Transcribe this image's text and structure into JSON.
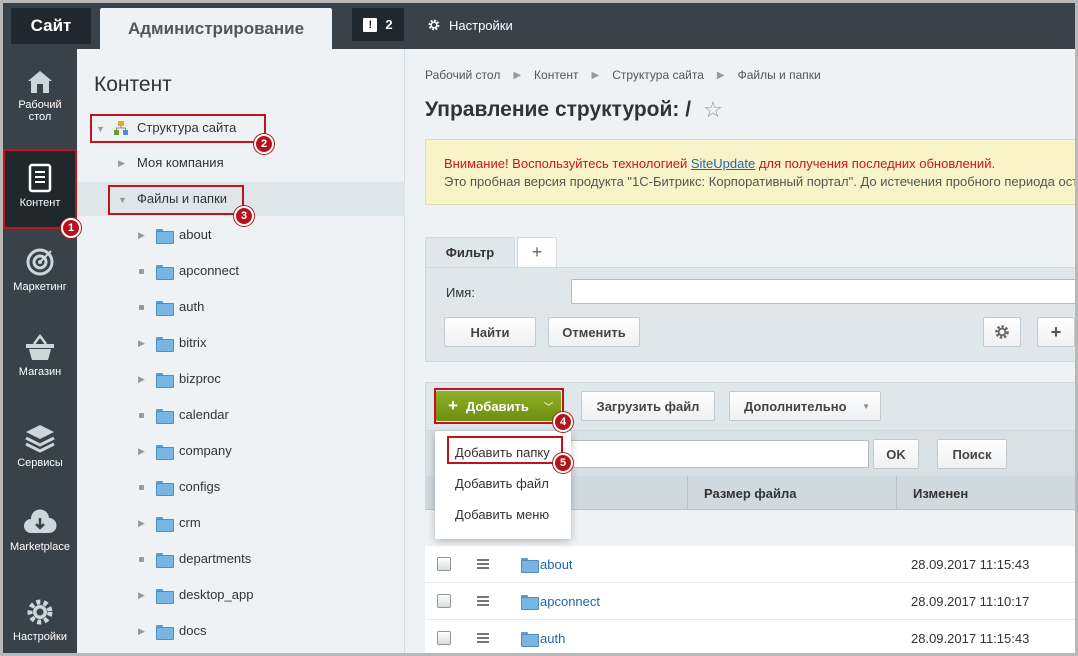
{
  "topbar": {
    "site_label": "Сайт",
    "admin_label": "Администрирование",
    "notifications_count": "2",
    "settings_label": "Настройки"
  },
  "leftnav": {
    "items": [
      {
        "label": "Рабочий стол",
        "icon": "home-icon"
      },
      {
        "label": "Контент",
        "icon": "document-icon",
        "active": true
      },
      {
        "label": "Маркетинг",
        "icon": "target-icon"
      },
      {
        "label": "Магазин",
        "icon": "basket-icon"
      },
      {
        "label": "Сервисы",
        "icon": "layers-icon"
      },
      {
        "label": "Marketplace",
        "icon": "cloud-download-icon"
      },
      {
        "label": "Настройки",
        "icon": "gear-icon"
      }
    ]
  },
  "tree": {
    "title": "Контент",
    "site_structure": "Структура сайта",
    "my_company": "Моя компания",
    "files_and_folders": "Файлы и папки",
    "folders": [
      {
        "name": "about",
        "expandable": true
      },
      {
        "name": "apconnect",
        "expandable": false
      },
      {
        "name": "auth",
        "expandable": false
      },
      {
        "name": "bitrix",
        "expandable": true
      },
      {
        "name": "bizproc",
        "expandable": true
      },
      {
        "name": "calendar",
        "expandable": false
      },
      {
        "name": "company",
        "expandable": true
      },
      {
        "name": "configs",
        "expandable": false
      },
      {
        "name": "crm",
        "expandable": true
      },
      {
        "name": "departments",
        "expandable": false
      },
      {
        "name": "desktop_app",
        "expandable": true
      },
      {
        "name": "docs",
        "expandable": true
      }
    ]
  },
  "badges": [
    "1",
    "2",
    "3",
    "4",
    "5"
  ],
  "main": {
    "breadcrumb": [
      "Рабочий стол",
      "Контент",
      "Структура сайта",
      "Файлы и папки"
    ],
    "title": "Управление структурой: /",
    "alert": {
      "warning_prefix": "Внимание! Воспользуйтесь технологией ",
      "link": "SiteUpdate",
      "warning_suffix": " для получения последних обновлений.",
      "trial_text": "Это пробная версия продукта \"1С-Битрикс: Корпоративный портал\". До истечения пробного периода ост"
    },
    "filter": {
      "tab_label": "Фильтр",
      "add_tab": "+",
      "name_label": "Имя:",
      "name_value": "",
      "find_button": "Найти",
      "cancel_button": "Отменить"
    },
    "toolbar": {
      "add_button": "Добавить",
      "upload_button": "Загрузить файл",
      "more_button": "Дополнительно"
    },
    "search": {
      "ok_button": "OK",
      "search_button": "Поиск",
      "value": ""
    },
    "dropdown": [
      "Добавить папку",
      "Добавить файл",
      "Добавить меню"
    ],
    "columns": [
      "Размер файла",
      "Изменен"
    ],
    "rows": [
      {
        "name": "about",
        "modified": "28.09.2017 11:15:43"
      },
      {
        "name": "apconnect",
        "modified": "28.09.2017 11:10:17"
      },
      {
        "name": "auth",
        "modified": "28.09.2017 11:15:43"
      }
    ]
  }
}
